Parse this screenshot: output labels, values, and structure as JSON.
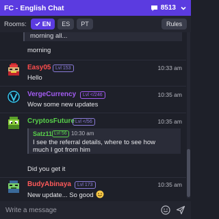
{
  "header": {
    "title": "FC - English Chat",
    "online_count": "8513"
  },
  "rooms": {
    "label": "Rooms:",
    "items": [
      {
        "label": "EN",
        "active": true
      },
      {
        "label": "ES",
        "active": false
      },
      {
        "label": "PT",
        "active": false
      }
    ],
    "rules_label": "Rules"
  },
  "feed": {
    "top_quote": "morning all...",
    "top_text": "morning",
    "messages": [
      {
        "username": "Easy05",
        "level": "Lvl 153",
        "time": "10:33 am",
        "text": "Hello",
        "name_color": "#ff4d4d",
        "level_color": "#8a7bd8"
      },
      {
        "username": "VergeCurrency",
        "level": "Lvl </246",
        "time": "10:35 am",
        "text": "Wow some new updates",
        "name_color": "#a35cf2",
        "level_color": "#a35cf2"
      },
      {
        "username": "CryptosFuture",
        "level": "Lvl </56",
        "time": "10:35 am",
        "text": "Did you get it",
        "name_color": "#58d04a",
        "level_color": "#8a7bd8",
        "reply": {
          "username": "Satz11",
          "level": "Lvl 56",
          "time": "10:30 am",
          "line1": "I see the referral details, where to see how",
          "line2": "much I got from him"
        }
      },
      {
        "username": "BudyAbinaya",
        "level": "Lvl 173",
        "time": "10:35 am",
        "text": "New update... So good",
        "name_color": "#ff5a5a",
        "level_color": "#8a7bd8"
      }
    ]
  },
  "composer": {
    "placeholder": "Write a message"
  },
  "colors": {
    "accent": "#5b3be0",
    "background": "#1e2029"
  }
}
